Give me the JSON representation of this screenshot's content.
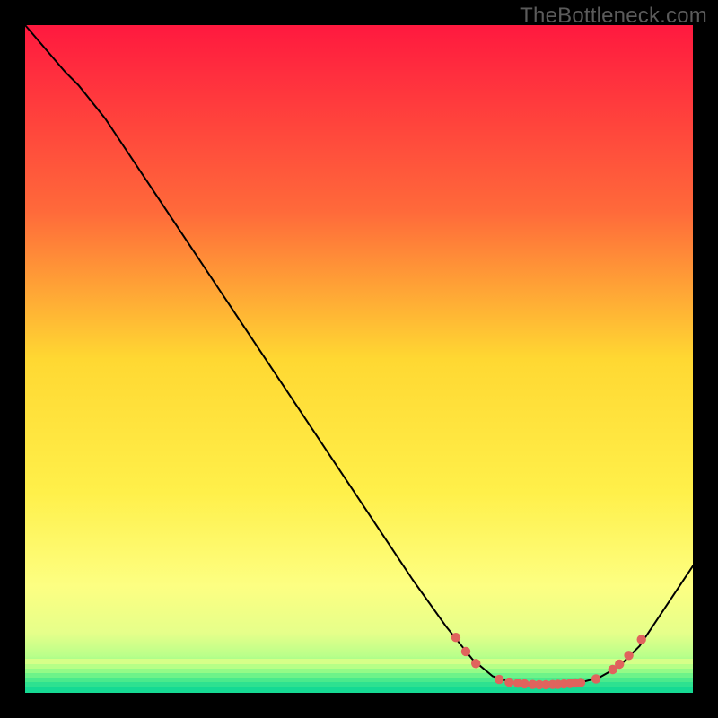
{
  "watermark": "TheBottleneck.com",
  "colors": {
    "black": "#000000",
    "curve": "#000000",
    "dot": "#e0635d",
    "gradient_top": "#ff193f",
    "gradient_mid_upper": "#ff8a3a",
    "gradient_mid": "#ffd832",
    "gradient_mid_lower": "#fff76a",
    "gradient_low": "#f1ff8f",
    "gradient_green1": "#b9ff8a",
    "gradient_green2": "#6df78a",
    "gradient_green3": "#2fe58f",
    "gradient_bottom": "#14db93"
  },
  "chart_data": {
    "type": "line",
    "title": "",
    "xlabel": "",
    "ylabel": "",
    "xlim": [
      0,
      100
    ],
    "ylim": [
      0,
      100
    ],
    "curve": [
      {
        "x": 0,
        "y": 100
      },
      {
        "x": 6,
        "y": 93
      },
      {
        "x": 8,
        "y": 91
      },
      {
        "x": 12,
        "y": 86
      },
      {
        "x": 20,
        "y": 74
      },
      {
        "x": 30,
        "y": 59
      },
      {
        "x": 40,
        "y": 44
      },
      {
        "x": 50,
        "y": 29
      },
      {
        "x": 58,
        "y": 17
      },
      {
        "x": 63,
        "y": 10
      },
      {
        "x": 67,
        "y": 5
      },
      {
        "x": 70,
        "y": 2.5
      },
      {
        "x": 73,
        "y": 1.5
      },
      {
        "x": 78,
        "y": 1.2
      },
      {
        "x": 83,
        "y": 1.5
      },
      {
        "x": 86,
        "y": 2.3
      },
      {
        "x": 89,
        "y": 4
      },
      {
        "x": 92,
        "y": 7
      },
      {
        "x": 96,
        "y": 13
      },
      {
        "x": 100,
        "y": 19
      }
    ],
    "highlight_dots": [
      {
        "x": 64.5,
        "y": 8.3
      },
      {
        "x": 66,
        "y": 6.2
      },
      {
        "x": 67.5,
        "y": 4.4
      },
      {
        "x": 71,
        "y": 2.0
      },
      {
        "x": 72.5,
        "y": 1.6
      },
      {
        "x": 73.8,
        "y": 1.45
      },
      {
        "x": 74.8,
        "y": 1.35
      },
      {
        "x": 76,
        "y": 1.25
      },
      {
        "x": 77,
        "y": 1.22
      },
      {
        "x": 78,
        "y": 1.22
      },
      {
        "x": 79,
        "y": 1.25
      },
      {
        "x": 79.8,
        "y": 1.28
      },
      {
        "x": 80.7,
        "y": 1.33
      },
      {
        "x": 81.6,
        "y": 1.4
      },
      {
        "x": 82.4,
        "y": 1.48
      },
      {
        "x": 83.2,
        "y": 1.55
      },
      {
        "x": 85.5,
        "y": 2.1
      },
      {
        "x": 88,
        "y": 3.5
      },
      {
        "x": 89,
        "y": 4.3
      },
      {
        "x": 90.4,
        "y": 5.6
      },
      {
        "x": 92.3,
        "y": 8.0
      }
    ],
    "green_band_y_range": [
      0,
      4
    ]
  }
}
